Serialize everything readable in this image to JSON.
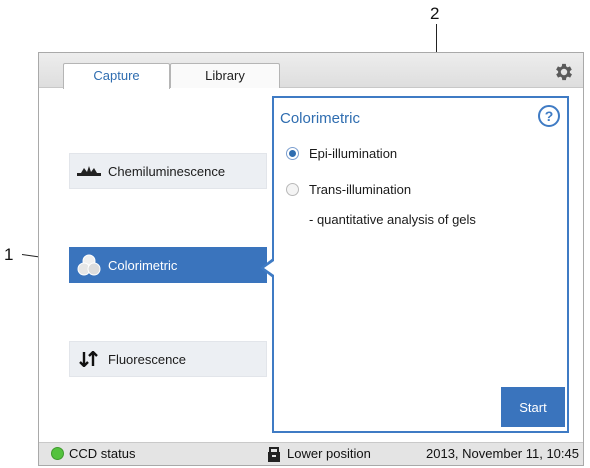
{
  "callouts": {
    "one": "1",
    "two": "2"
  },
  "tabs": {
    "capture": "Capture",
    "library": "Library"
  },
  "modes": {
    "chemiluminescence": "Chemiluminescence",
    "colorimetric": "Colorimetric",
    "fluorescence": "Fluorescence",
    "selected": "Colorimetric"
  },
  "panel": {
    "title": "Colorimetric",
    "help": "?",
    "options": {
      "epi": {
        "label": "Epi-illumination",
        "selected": true
      },
      "trans": {
        "label": "Trans-illumination",
        "selected": false
      }
    },
    "note": "- quantitative analysis of gels",
    "start": "Start"
  },
  "status": {
    "ccd": "CCD status",
    "position": "Lower position",
    "datetime": "2013, November 11, 10:45"
  },
  "icons": {
    "settings": "gear-icon",
    "help": "help-icon",
    "chemiluminescence": "chemiluminescence-icon",
    "colorimetric": "colorimetric-icon",
    "fluorescence": "fluorescence-icon",
    "status": "status-dot-icon",
    "position": "lock-icon"
  },
  "colors": {
    "accent": "#3a74bd",
    "panel_border": "#3f7bc4",
    "status_ok": "#54c23e"
  }
}
